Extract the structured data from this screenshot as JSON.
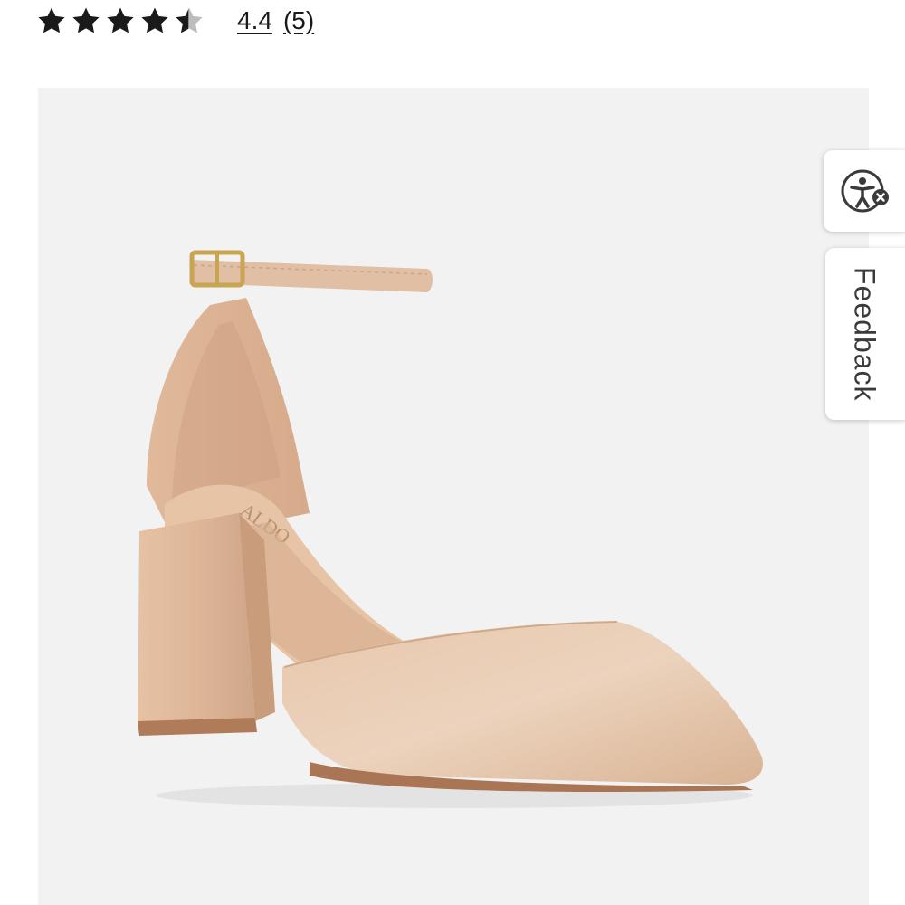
{
  "rating": {
    "value": "4.4",
    "count": "(5)",
    "stars_filled": 4.4,
    "stars_total": 5,
    "star_color": "#1a1a1a",
    "star_empty_color": "#bdbdbd"
  },
  "product_image": {
    "background": "#f2f2f2",
    "shoe_color": "#e2bfa3",
    "brand_imprint": "ALDO"
  },
  "side_widgets": {
    "accessibility_icon": "accessibility-icon",
    "feedback_label": "Feedback"
  }
}
